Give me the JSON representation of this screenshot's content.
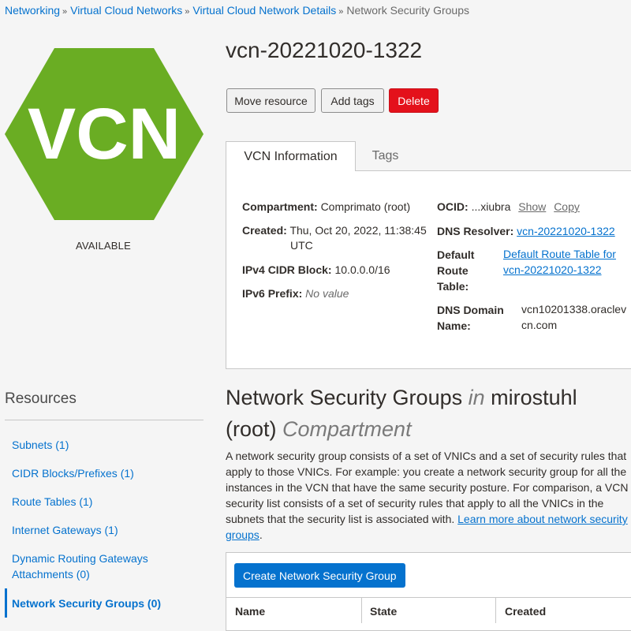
{
  "breadcrumb": {
    "items": [
      "Networking",
      "Virtual Cloud Networks",
      "Virtual Cloud Network Details"
    ],
    "current": "Network Security Groups"
  },
  "badge": {
    "text": "VCN",
    "color": "#6aad23",
    "status": "AVAILABLE"
  },
  "title": "vcn-20221020-1322",
  "actions": {
    "move": "Move resource",
    "tags": "Add tags",
    "delete": "Delete"
  },
  "tabs": {
    "active": "VCN Information",
    "inactive": "Tags"
  },
  "info": {
    "compartment_label": "Compartment:",
    "compartment_value": "Comprimato (root)",
    "created_label": "Created:",
    "created_value_1": "Thu, Oct 20, 2022, 11:38:45",
    "created_value_2": "UTC",
    "ipv4_label": "IPv4 CIDR Block:",
    "ipv4_value": "10.0.0.0/16",
    "ipv6_label": "IPv6 Prefix:",
    "ipv6_value": "No value",
    "ocid_label": "OCID:",
    "ocid_value": "...xiubra",
    "show": "Show",
    "copy": "Copy",
    "dns_resolver_label": "DNS Resolver:",
    "dns_resolver_value": "vcn-20221020-1322",
    "default_rt_label_1": "Default",
    "default_rt_label_2": "Route",
    "default_rt_label_3": "Table:",
    "default_rt_value_1": "Default Route Table for",
    "default_rt_value_2": "vcn-20221020-1322",
    "dns_domain_label_1": "DNS Domain",
    "dns_domain_label_2": "Name:",
    "dns_domain_value_1": "vcn10201338.oraclev",
    "dns_domain_value_2": "cn.com"
  },
  "resources": {
    "title": "Resources",
    "items": [
      "Subnets (1)",
      "CIDR Blocks/Prefixes (1)",
      "Route Tables (1)",
      "Internet Gateways (1)",
      "Dynamic Routing Gateways",
      "Attachments (0)",
      "Network Security Groups (0)"
    ]
  },
  "section": {
    "title_1": "Network Security Groups ",
    "title_in": "in",
    "title_2": " mirostuhl",
    "title_3": "(root) ",
    "title_comp": "Compartment",
    "desc_1": "A network security group consists of a set of VNICs and a set of security rules that",
    "desc_2": "apply to those VNICs. For example: you create a network security group for all the",
    "desc_3": "instances in the VCN that have the same security posture. For comparison, a VCN",
    "desc_4": "security list consists of a set of security rules that apply to all the VNICs in the",
    "desc_5a": "subnets that the security list is associated with. ",
    "desc_link_1": "Learn more about network security",
    "desc_link_2": "groups",
    "desc_end": "."
  },
  "table": {
    "create_button": "Create Network Security Group",
    "columns": [
      "Name",
      "State",
      "Created"
    ]
  }
}
